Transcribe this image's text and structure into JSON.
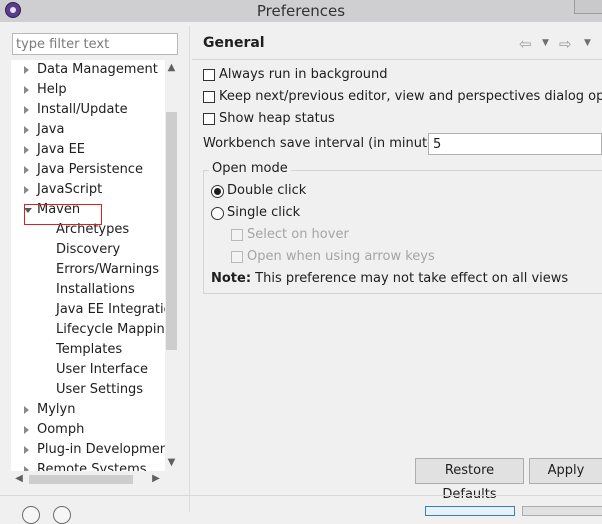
{
  "window": {
    "title": "Preferences"
  },
  "filter": {
    "placeholder": "type filter text",
    "value": ""
  },
  "tree": {
    "items": [
      {
        "label": "Data Management",
        "level": 0,
        "state": "collapsed"
      },
      {
        "label": "Help",
        "level": 0,
        "state": "collapsed"
      },
      {
        "label": "Install/Update",
        "level": 0,
        "state": "collapsed"
      },
      {
        "label": "Java",
        "level": 0,
        "state": "collapsed"
      },
      {
        "label": "Java EE",
        "level": 0,
        "state": "collapsed"
      },
      {
        "label": "Java Persistence",
        "level": 0,
        "state": "collapsed"
      },
      {
        "label": "JavaScript",
        "level": 0,
        "state": "collapsed"
      },
      {
        "label": "Maven",
        "level": 0,
        "state": "expanded"
      },
      {
        "label": "Archetypes",
        "level": 1,
        "state": "leaf"
      },
      {
        "label": "Discovery",
        "level": 1,
        "state": "leaf"
      },
      {
        "label": "Errors/Warnings",
        "level": 1,
        "state": "leaf"
      },
      {
        "label": "Installations",
        "level": 1,
        "state": "leaf"
      },
      {
        "label": "Java EE Integration",
        "level": 1,
        "state": "leaf"
      },
      {
        "label": "Lifecycle Mappings",
        "level": 1,
        "state": "leaf"
      },
      {
        "label": "Templates",
        "level": 1,
        "state": "leaf"
      },
      {
        "label": "User Interface",
        "level": 1,
        "state": "leaf"
      },
      {
        "label": "User Settings",
        "level": 1,
        "state": "leaf"
      },
      {
        "label": "Mylyn",
        "level": 0,
        "state": "collapsed"
      },
      {
        "label": "Oomph",
        "level": 0,
        "state": "collapsed"
      },
      {
        "label": "Plug-in Development",
        "level": 0,
        "state": "collapsed"
      },
      {
        "label": "Remote Systems",
        "level": 0,
        "state": "collapsed"
      }
    ]
  },
  "page": {
    "title": "General",
    "always_run_background": {
      "label": "Always run in background",
      "checked": false
    },
    "keep_next_prev": {
      "label": "Keep next/previous editor, view and perspectives dialog open",
      "checked": false
    },
    "show_heap": {
      "label": "Show heap status",
      "checked": false
    },
    "save_interval": {
      "label": "Workbench save interval (in minutes):",
      "value": "5"
    },
    "open_mode": {
      "legend": "Open mode",
      "double_click": {
        "label": "Double click",
        "checked": true
      },
      "single_click": {
        "label": "Single click",
        "checked": false
      },
      "select_on_hover": {
        "label": "Select on hover",
        "enabled": false
      },
      "open_arrow_keys": {
        "label": "Open when using arrow keys",
        "enabled": false
      }
    },
    "note": {
      "bold": "Note:",
      "text": " This preference may not take effect on all views"
    }
  },
  "buttons": {
    "restore_defaults": "Restore Defaults",
    "apply": "Apply"
  },
  "icons": {
    "back": "arrow-left-icon",
    "forward": "arrow-right-icon",
    "menu": "dropdown-icon",
    "app": "preferences-app-icon",
    "scroll_up": "scroll-up-icon",
    "scroll_down": "scroll-down-icon",
    "scroll_left": "scroll-left-icon",
    "scroll_right": "scroll-right-icon"
  },
  "colors": {
    "highlight_box": "#e02020",
    "titlebar": "#cfcfd1",
    "background": "#f0f0f0"
  }
}
